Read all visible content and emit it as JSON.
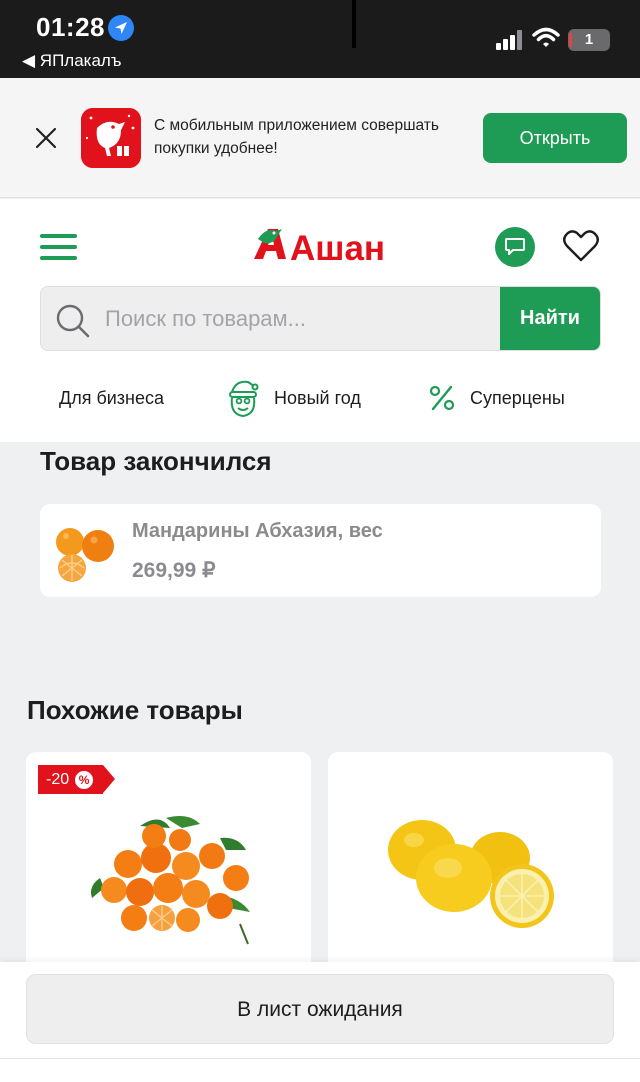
{
  "status_bar": {
    "time": "01:28",
    "back_app": "◀ ЯПлакалъ",
    "battery": "1"
  },
  "app_banner": {
    "message": "С мобильным приложением совершать покупки удобнее!",
    "open_label": "Открыть"
  },
  "header": {
    "logo_text": "Ашан",
    "search_placeholder": "Поиск по товарам...",
    "search_button": "Найти",
    "quick_links": [
      {
        "label": "Для бизнеса"
      },
      {
        "label": "Новый год"
      },
      {
        "label": "Суперцены"
      }
    ]
  },
  "out_of_stock": {
    "title": "Товар закончился",
    "product_name": "Мандарины Абхазия, вес",
    "price": "269,99 ₽"
  },
  "similar": {
    "title": "Похожие товары",
    "products": [
      {
        "badge": "-20",
        "badge_icon": "%"
      },
      {}
    ]
  },
  "actions": {
    "waitlist_label": "В лист ожидания"
  },
  "colors": {
    "brand_green": "#1e9c55",
    "brand_red": "#e1121c"
  }
}
